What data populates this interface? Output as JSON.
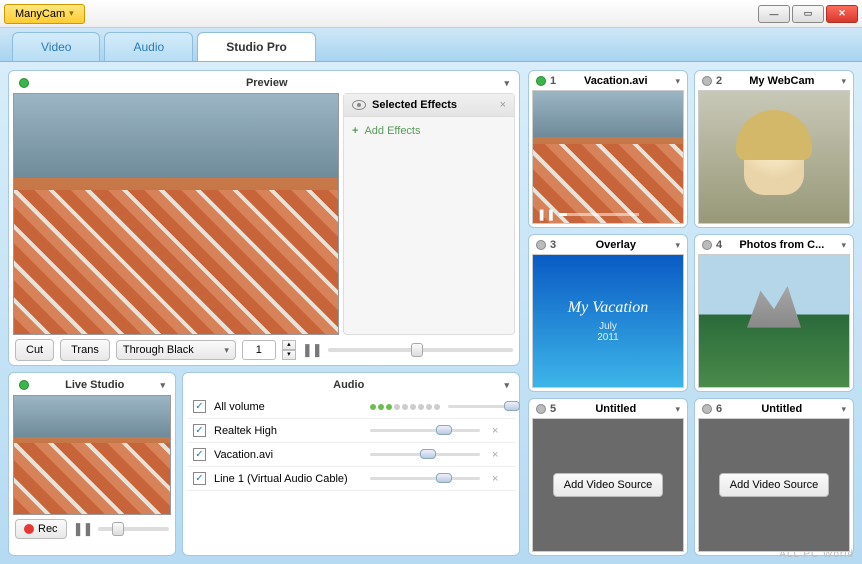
{
  "app": {
    "title": "ManyCam"
  },
  "tabs": {
    "video": "Video",
    "audio": "Audio",
    "studio": "Studio Pro"
  },
  "preview": {
    "title": "Preview",
    "effects_title": "Selected Effects",
    "add_effects": "Add Effects",
    "cut": "Cut",
    "trans": "Trans",
    "transition_mode": "Through Black",
    "duration": "1"
  },
  "live": {
    "title": "Live Studio",
    "rec": "Rec"
  },
  "audio_panel": {
    "title": "Audio",
    "rows": [
      {
        "label": "All volume",
        "has_vu": true,
        "slider_pos": "92%"
      },
      {
        "label": "Realtek High",
        "has_vu": false,
        "slider_pos": "60%"
      },
      {
        "label": "Vacation.avi",
        "has_vu": false,
        "slider_pos": "45%"
      },
      {
        "label": "Line 1 (Virtual Audio Cable)",
        "has_vu": false,
        "slider_pos": "60%"
      }
    ]
  },
  "sources": [
    {
      "num": "1",
      "title": "Vacation.avi",
      "kind": "vacation",
      "active": true
    },
    {
      "num": "2",
      "title": "My WebCam",
      "kind": "webcam",
      "active": false
    },
    {
      "num": "3",
      "title": "Overlay",
      "kind": "overlay",
      "active": false
    },
    {
      "num": "4",
      "title": "Photos from C...",
      "kind": "photos",
      "active": false
    },
    {
      "num": "5",
      "title": "Untitled",
      "kind": "empty",
      "active": false
    },
    {
      "num": "6",
      "title": "Untitled",
      "kind": "empty",
      "active": false
    }
  ],
  "overlay": {
    "title": "My Vacation",
    "sub1": "July",
    "sub2": "2011"
  },
  "add_source": "Add Video Source",
  "watermark": "ALL PC World"
}
